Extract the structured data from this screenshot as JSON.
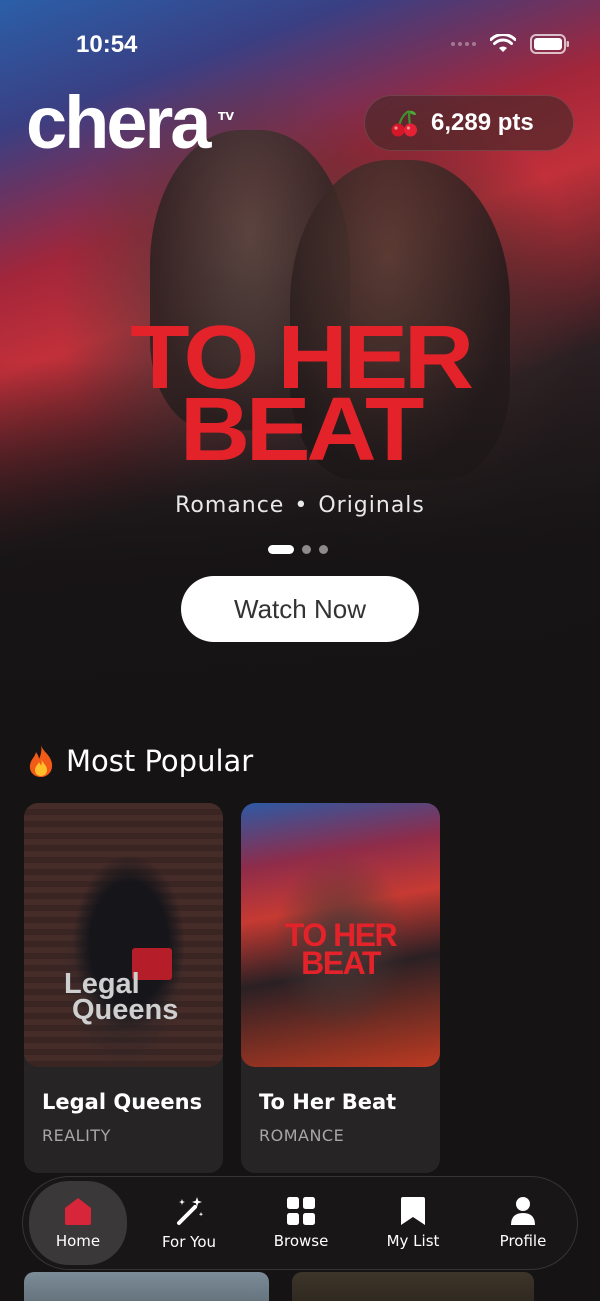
{
  "status": {
    "time": "10:54"
  },
  "brand": {
    "logo": "chera",
    "logo_suffix": "TV"
  },
  "points": {
    "icon": "cherry-icon",
    "label": "6,289 pts"
  },
  "hero": {
    "title_line1": "TO HER",
    "title_line2": "BEAT",
    "genre": "Romance",
    "separator": "•",
    "category": "Originals",
    "carousel": {
      "count": 3,
      "active_index": 0
    },
    "cta_label": "Watch Now"
  },
  "most_popular": {
    "icon": "fire-icon",
    "title": "Most Popular",
    "items": [
      {
        "name": "Legal Queens",
        "genre": "REALITY",
        "poster_title_line1": "Legal",
        "poster_title_line2": "Queens"
      },
      {
        "name": "To Her Beat",
        "genre": "ROMANCE",
        "poster_title_line1": "TO HER",
        "poster_title_line2": "BEAT"
      }
    ]
  },
  "tabbar": {
    "active": "Home",
    "tabs": [
      {
        "label": "Home",
        "icon": "home-icon"
      },
      {
        "label": "For You",
        "icon": "magic-wand-icon"
      },
      {
        "label": "Browse",
        "icon": "grid-icon"
      },
      {
        "label": "My List",
        "icon": "bookmark-icon"
      },
      {
        "label": "Profile",
        "icon": "person-icon"
      }
    ]
  },
  "colors": {
    "accent": "#e4222a",
    "background": "#151314",
    "card": "#262425"
  }
}
